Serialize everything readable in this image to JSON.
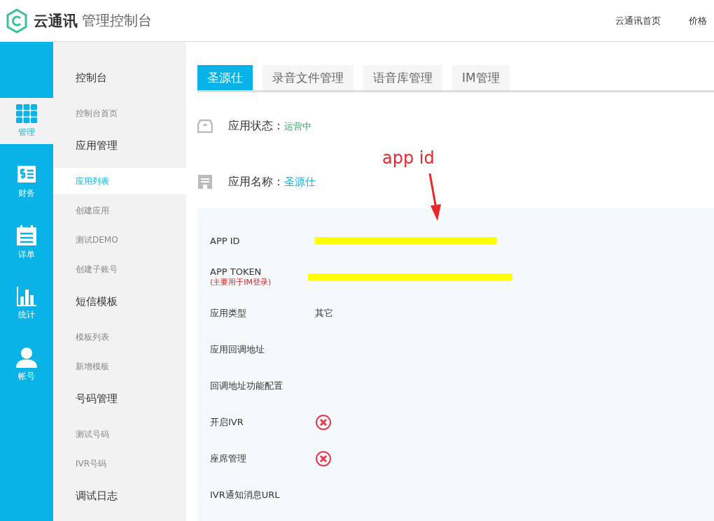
{
  "header": {
    "brand": "云通讯",
    "product": "管理控制台",
    "links": [
      {
        "label": "云通讯首页"
      },
      {
        "label": "价格"
      }
    ]
  },
  "rail": [
    {
      "label": "管理",
      "selected": true
    },
    {
      "label": "财务",
      "selected": false
    },
    {
      "label": "详单",
      "selected": false
    },
    {
      "label": "统计",
      "selected": false
    },
    {
      "label": "帐号",
      "selected": false
    }
  ],
  "menu": [
    {
      "title": "控制台",
      "items": [
        {
          "label": "控制台首页",
          "selected": false
        }
      ]
    },
    {
      "title": "应用管理",
      "items": [
        {
          "label": "应用列表",
          "selected": true
        },
        {
          "label": "创建应用",
          "selected": false
        },
        {
          "label": "测试DEMO",
          "selected": false
        },
        {
          "label": "创建子账号",
          "selected": false
        }
      ]
    },
    {
      "title": "短信模板",
      "items": [
        {
          "label": "模板列表",
          "selected": false
        },
        {
          "label": "新增模板",
          "selected": false
        }
      ]
    },
    {
      "title": "号码管理",
      "items": [
        {
          "label": "测试号码",
          "selected": false
        },
        {
          "label": "IVR号码",
          "selected": false
        }
      ]
    },
    {
      "title": "调试日志"
    }
  ],
  "tabs": [
    {
      "label": "圣源仕",
      "selected": true
    },
    {
      "label": "录音文件管理",
      "selected": false
    },
    {
      "label": "语音库管理",
      "selected": false
    },
    {
      "label": "IM管理",
      "selected": false
    }
  ],
  "status": {
    "label": "应用状态：",
    "value": "运营中"
  },
  "name": {
    "label": "应用名称：",
    "value": "圣源仕"
  },
  "annotation": {
    "text": "app id"
  },
  "fields": [
    {
      "label": "APP ID",
      "kind": "redacted"
    },
    {
      "label": "APP TOKEN",
      "note": "(主要用于IM登录)",
      "kind": "redacted"
    },
    {
      "label": "应用类型",
      "kind": "text",
      "value": "其它"
    },
    {
      "label": "应用回调地址",
      "kind": "empty"
    },
    {
      "label": "回调地址功能配置",
      "kind": "empty"
    },
    {
      "label": "开启IVR",
      "kind": "status",
      "enabled": false
    },
    {
      "label": "座席管理",
      "kind": "status",
      "enabled": false
    },
    {
      "label": "IVR通知消息URL",
      "kind": "empty"
    }
  ]
}
